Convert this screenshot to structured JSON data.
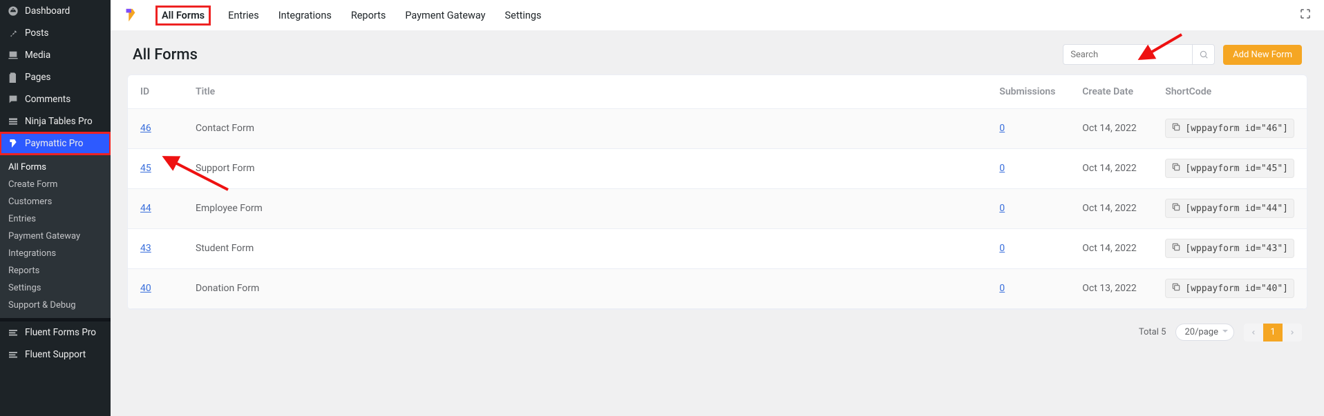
{
  "sidebar": {
    "top_items": [
      {
        "icon": "dash",
        "label": "Dashboard"
      },
      {
        "icon": "pin",
        "label": "Posts"
      },
      {
        "icon": "media",
        "label": "Media"
      },
      {
        "icon": "page",
        "label": "Pages"
      },
      {
        "icon": "comment",
        "label": "Comments"
      },
      {
        "icon": "ninja",
        "label": "Ninja Tables Pro"
      },
      {
        "icon": "paymattic",
        "label": "Paymattic Pro",
        "active": true
      }
    ],
    "sub_items": [
      "All Forms",
      "Create Form",
      "Customers",
      "Entries",
      "Payment Gateway",
      "Integrations",
      "Reports",
      "Settings",
      "Support & Debug"
    ],
    "bottom_items": [
      {
        "icon": "fluent",
        "label": "Fluent Forms Pro"
      },
      {
        "icon": "fluent",
        "label": "Fluent Support"
      }
    ]
  },
  "topbar": {
    "tabs": [
      "All Forms",
      "Entries",
      "Integrations",
      "Reports",
      "Payment Gateway",
      "Settings"
    ]
  },
  "header": {
    "title": "All Forms",
    "search_placeholder": "Search",
    "add_button": "Add New Form"
  },
  "table": {
    "columns": [
      "ID",
      "Title",
      "Submissions",
      "Create Date",
      "ShortCode"
    ],
    "rows": [
      {
        "id": "46",
        "title": "Contact Form",
        "subs": "0",
        "date": "Oct 14, 2022",
        "code": "[wppayform id=\"46\"]"
      },
      {
        "id": "45",
        "title": "Support Form",
        "subs": "0",
        "date": "Oct 14, 2022",
        "code": "[wppayform id=\"45\"]"
      },
      {
        "id": "44",
        "title": "Employee Form",
        "subs": "0",
        "date": "Oct 14, 2022",
        "code": "[wppayform id=\"44\"]"
      },
      {
        "id": "43",
        "title": "Student Form",
        "subs": "0",
        "date": "Oct 14, 2022",
        "code": "[wppayform id=\"43\"]"
      },
      {
        "id": "40",
        "title": "Donation Form",
        "subs": "0",
        "date": "Oct 13, 2022",
        "code": "[wppayform id=\"40\"]"
      }
    ]
  },
  "footer": {
    "total_label": "Total 5",
    "page_size": "20/page",
    "current_page": "1"
  }
}
